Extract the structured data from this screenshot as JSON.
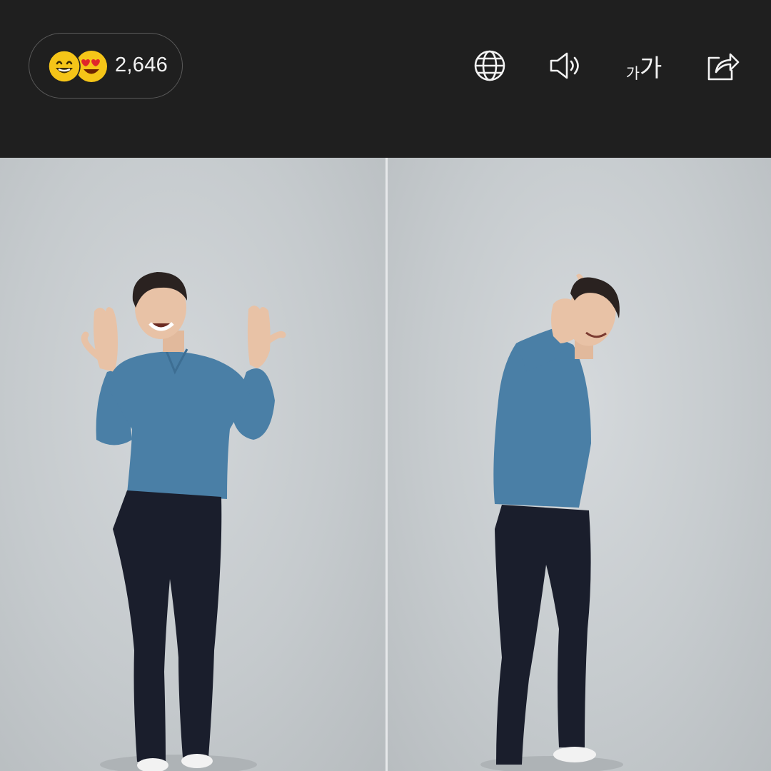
{
  "header": {
    "reactions": {
      "count": "2,646",
      "emoji_icons": [
        "grinning-face-icon",
        "heart-eyes-face-icon"
      ],
      "emoji_color": "#f5c518"
    },
    "toolbar": {
      "icons": [
        "globe-icon",
        "speaker-icon",
        "font-size-icon",
        "share-icon"
      ],
      "font_size_small": "가",
      "font_size_large": "가"
    }
  },
  "colors": {
    "header_bg": "#1f1f1f",
    "icon": "#f2f2f2",
    "shirt": "#4a7fa6",
    "trousers": "#1a1e2c",
    "backdrop": "#c8cdd0"
  }
}
